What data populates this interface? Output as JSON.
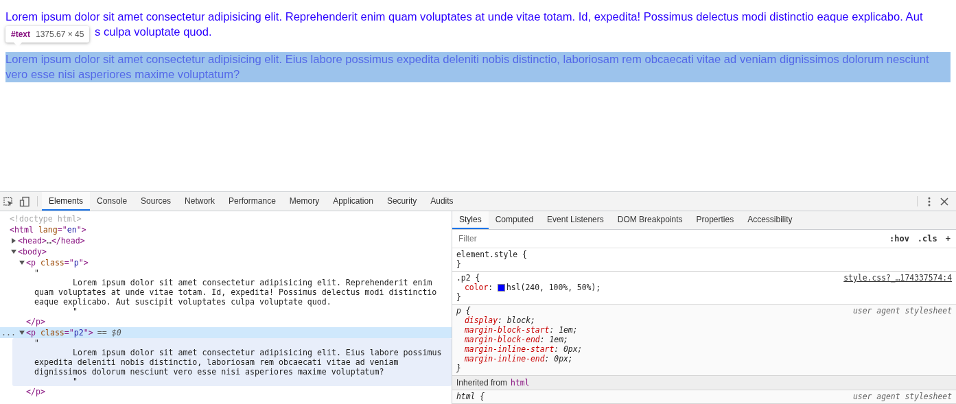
{
  "page": {
    "paragraphs": [
      {
        "highlighted": false,
        "lines": [
          "Lorem ipsum dolor sit amet consectetur adipisicing elit. Reprehenderit enim quam voluptates at unde vitae totam. Id, expedita! Possimus delectus modi distinctio eaque explicabo. Aut",
          "s culpa voluptate quod."
        ]
      },
      {
        "highlighted": true,
        "lines": [
          "Lorem ipsum dolor sit amet consectetur adipisicing elit. Eius labore possimus expedita deleniti nobis distinctio, laboriosam rem obcaecati vitae ad veniam dignissimos dolorum nesciunt",
          "vero esse nisi asperiores maxime voluptatum?"
        ]
      }
    ],
    "tooltip": {
      "node": "#text",
      "size": "1375.67 × 45"
    }
  },
  "devtools": {
    "tabs": [
      {
        "label": "Elements",
        "selected": true
      },
      {
        "label": "Console",
        "selected": false
      },
      {
        "label": "Sources",
        "selected": false
      },
      {
        "label": "Network",
        "selected": false
      },
      {
        "label": "Performance",
        "selected": false
      },
      {
        "label": "Memory",
        "selected": false
      },
      {
        "label": "Application",
        "selected": false
      },
      {
        "label": "Security",
        "selected": false
      },
      {
        "label": "Audits",
        "selected": false
      }
    ],
    "dom_tree": [
      {
        "kind": "doctype",
        "text": "<!doctype html>"
      },
      {
        "kind": "element",
        "open": [
          {
            "kind": "tag",
            "s": "<html"
          },
          {
            "kind": "attr",
            "s": " lang"
          },
          {
            "kind": "tag",
            "s": "=\""
          },
          {
            "kind": "val",
            "s": "en"
          },
          {
            "kind": "tag",
            "s": "\">"
          }
        ],
        "children": [
          {
            "kind": "element",
            "expanded": false,
            "open": [
              {
                "kind": "tag",
                "s": "<head>"
              },
              {
                "kind": "plain",
                "s": "…"
              },
              {
                "kind": "tag",
                "s": "</head>"
              }
            ]
          },
          {
            "kind": "element",
            "expanded": true,
            "open": [
              {
                "kind": "tag",
                "s": "<body>"
              }
            ],
            "children": [
              {
                "kind": "element",
                "expanded": true,
                "selected": false,
                "open": [
                  {
                    "kind": "tag",
                    "s": "<p"
                  },
                  {
                    "kind": "attr",
                    "s": " class"
                  },
                  {
                    "kind": "tag",
                    "s": "=\""
                  },
                  {
                    "kind": "val",
                    "s": "p"
                  },
                  {
                    "kind": "tag",
                    "s": "\">"
                  }
                ],
                "children": [
                  {
                    "kind": "text",
                    "quote_open": "\"",
                    "text": "Lorem ipsum dolor sit amet consectetur adipisicing elit. Reprehenderit enim quam voluptates at unde vitae totam. Id, expedita! Possimus delectus modi distinctio eaque explicabo. Aut suscipit voluptates culpa voluptate quod.",
                    "quote_close": "\""
                  }
                ],
                "close": "</p>"
              },
              {
                "kind": "element",
                "expanded": true,
                "selected": true,
                "gutter": "...",
                "marker": "== $0",
                "open": [
                  {
                    "kind": "tag",
                    "s": "<p"
                  },
                  {
                    "kind": "attr",
                    "s": " class"
                  },
                  {
                    "kind": "tag",
                    "s": "=\""
                  },
                  {
                    "kind": "val",
                    "s": "p2"
                  },
                  {
                    "kind": "tag",
                    "s": "\">"
                  }
                ],
                "children": [
                  {
                    "kind": "text",
                    "quote_open": "\"",
                    "text": "Lorem ipsum dolor sit amet consectetur adipisicing elit. Eius labore possimus expedita deleniti nobis distinctio, laboriosam rem obcaecati vitae ad veniam dignissimos dolorum nesciunt vero esse nisi asperiores maxime voluptatum?",
                    "quote_close": "\""
                  }
                ],
                "close": "</p>"
              }
            ]
          }
        ]
      }
    ],
    "sidebar": {
      "tabs": [
        {
          "label": "Styles",
          "selected": true
        },
        {
          "label": "Computed",
          "selected": false
        },
        {
          "label": "Event Listeners",
          "selected": false
        },
        {
          "label": "DOM Breakpoints",
          "selected": false
        },
        {
          "label": "Properties",
          "selected": false
        },
        {
          "label": "Accessibility",
          "selected": false
        }
      ],
      "filter": {
        "placeholder": "Filter"
      },
      "toolbar": [
        ":hov",
        ".cls",
        "+"
      ],
      "rules": [
        {
          "kind": "rule",
          "selector": "element.style {",
          "close": "}",
          "ua": false
        },
        {
          "kind": "rule",
          "selector": ".p2 {",
          "source": "style.css?_…174337574:4",
          "close": "}",
          "ua": false,
          "declarations": [
            {
              "prop": "color",
              "separator": ":",
              "value": "hsl(240, 100%, 50%);",
              "color": "#0000ff"
            }
          ]
        },
        {
          "kind": "rule",
          "selector": "p {",
          "source": "user agent stylesheet",
          "close": "}",
          "ua": true,
          "declarations": [
            {
              "prop": "display",
              "separator": ":",
              "value": "block;"
            },
            {
              "prop": "margin-block-start",
              "separator": ":",
              "value": "1em;"
            },
            {
              "prop": "margin-block-end",
              "separator": ":",
              "value": "1em;"
            },
            {
              "prop": "margin-inline-start",
              "separator": ":",
              "value": "0px;"
            },
            {
              "prop": "margin-inline-end",
              "separator": ":",
              "value": "0px;"
            }
          ]
        },
        {
          "kind": "inherited",
          "label": "Inherited from",
          "target": "html"
        },
        {
          "kind": "rule",
          "selector": "html {",
          "source": "user agent stylesheet",
          "ua": true
        }
      ]
    }
  }
}
